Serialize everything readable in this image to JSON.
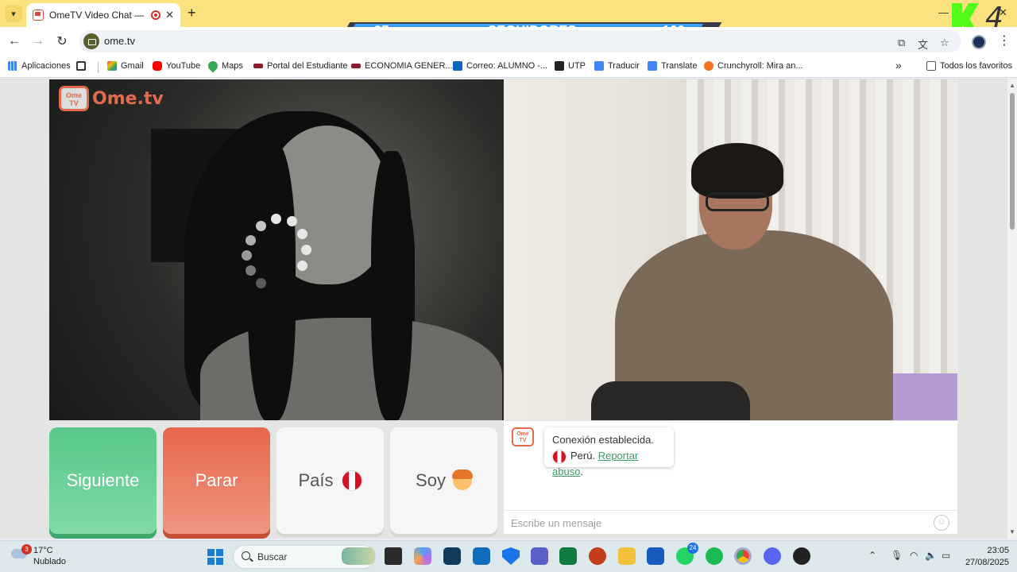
{
  "tab": {
    "title": "OmeTV Video Chat — Ome",
    "new_tab": "+"
  },
  "overlay": {
    "follow_current": "97",
    "follow_label": "SEGUIDORES",
    "follow_goal": "100",
    "follow_progress": 0.97,
    "kick_count": "4"
  },
  "address_bar": {
    "url": "ome.tv"
  },
  "bookmarks": [
    {
      "label": "Aplicaciones",
      "icon": "apps-grid-icon"
    },
    {
      "label": "Gmail",
      "icon": "gmail-icon"
    },
    {
      "label": "YouTube",
      "icon": "youtube-icon"
    },
    {
      "label": "Maps",
      "icon": "maps-pin-icon"
    },
    {
      "label": "Portal del Estudiante",
      "icon": "portal-icon"
    },
    {
      "label": "ECONOMIA GENER...",
      "icon": "economia-icon"
    },
    {
      "label": "Correo: ALUMNO -...",
      "icon": "outlook-icon"
    },
    {
      "label": "UTP",
      "icon": "utp-icon"
    },
    {
      "label": "Traducir",
      "icon": "translate-icon"
    },
    {
      "label": "Translate",
      "icon": "translate-icon"
    },
    {
      "label": "Crunchyroll: Mira an...",
      "icon": "crunchyroll-icon"
    }
  ],
  "bookmarks_more": "»",
  "bookmarks_all": "Todos los favoritos",
  "site": {
    "logo_small": "Ome TV",
    "logo_text": "Ome.tv",
    "buttons": {
      "next": "Siguiente",
      "stop": "Parar",
      "country": "País",
      "gender": "Soy"
    },
    "chat": {
      "connected": "Conexión establecida.",
      "country": "Perú.",
      "report": "Reportar abuso",
      "report_suffix": ".",
      "placeholder": "Escribe un mensaje"
    }
  },
  "taskbar": {
    "weather_temp": "17°C",
    "weather_desc": "Nublado",
    "weather_badge": "3",
    "search": "Buscar",
    "whatsapp_badge": "24",
    "time": "23:05",
    "date": "27/08/2025"
  },
  "colors": {
    "next": "#58c789",
    "stop": "#e6664b",
    "brand": "#e26a4d",
    "link": "#3b9b6a"
  }
}
